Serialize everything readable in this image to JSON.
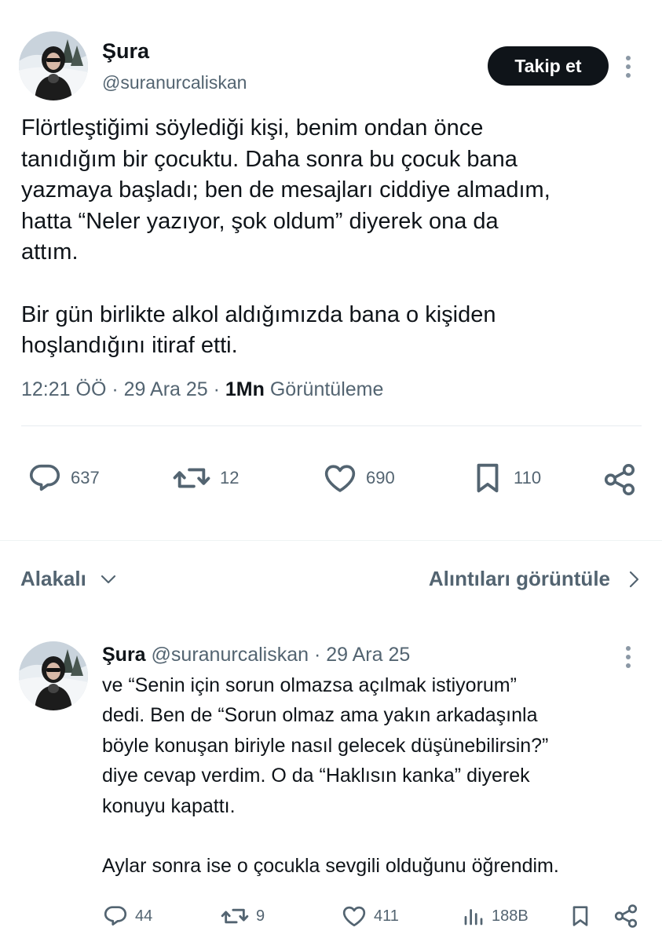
{
  "tweet": {
    "author_name": "Şura",
    "author_handle": "@suranurcaliskan",
    "follow_label": "Takip et",
    "paragraphs": [
      "Flörtleştiğimi söylediği kişi, benim ondan önce\ntanıdığım bir çocuktu. Daha sonra bu çocuk bana\nyazmaya başladı; ben de mesajları ciddiye almadım,\nhatta “Neler yazıyor, şok oldum” diyerek ona da\nattım.",
      "Bir gün birlikte alkol aldığımızda bana o kişiden\nhoşlandığını itiraf etti."
    ],
    "time": "12:21 ÖÖ",
    "date": "29 Ara 25",
    "views_count": "1Mn",
    "views_label": "Görüntüleme",
    "replies": "637",
    "reposts": "12",
    "likes": "690",
    "bookmarks": "110"
  },
  "related_bar": {
    "left_label": "Alakalı",
    "right_label": "Alıntıları görüntüle"
  },
  "reply": {
    "author_name": "Şura",
    "author_handle": "@suranurcaliskan",
    "date": "29 Ara 25",
    "paragraphs": [
      "ve “Senin için sorun olmazsa açılmak istiyorum”\ndedi. Ben de “Sorun olmaz ama yakın arkadaşınla\nböyle konuşan biriyle nasıl gelecek düşünebilirsin?”\ndiye cevap verdim. O da “Haklısın kanka” diyerek\nkonuyu kapattı.",
      "Aylar sonra ise o çocukla sevgili olduğunu öğrendim."
    ],
    "replies": "44",
    "reposts": "9",
    "likes": "411",
    "views": "188B"
  },
  "icons": {
    "reply": "speech-bubble-icon",
    "repost": "repost-arrows-icon",
    "like": "heart-icon",
    "bookmark": "bookmark-icon",
    "share": "share-icon",
    "views": "bar-chart-icon",
    "more": "three-dots-vertical-icon",
    "related": "chevron-down-icon",
    "quotes": "chevron-right-icon"
  },
  "colors": {
    "text_primary": "#0f1419",
    "text_secondary": "#536471",
    "button_bg": "#0f1419",
    "button_text": "#ffffff",
    "divider": "#e6ecf0"
  }
}
